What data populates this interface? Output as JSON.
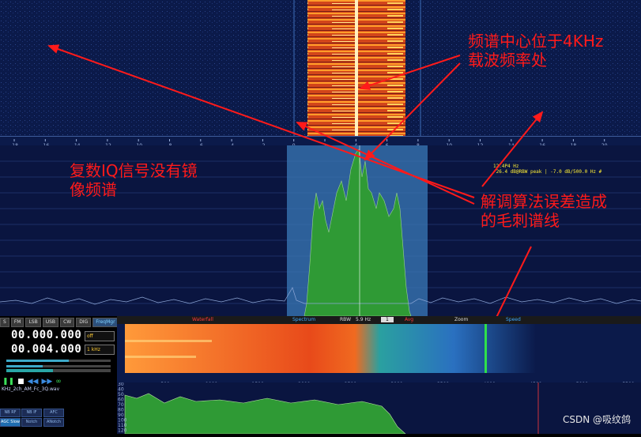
{
  "annotations": {
    "center_line1": "频谱中心位于4KHz",
    "center_line2": "载波频率处",
    "iq_line1": "复数IQ信号没有镜",
    "iq_line2": "像频谱",
    "spur_line1": "解调算法误差造成",
    "spur_line2": "的毛刺谱线"
  },
  "top_axis_ticks": [
    "-18",
    "-16",
    "-14",
    "-12",
    "-10",
    "-8",
    "-6",
    "-4",
    "-2",
    "0",
    "2",
    "4",
    "6",
    "8",
    "10",
    "12",
    "14",
    "16",
    "18",
    "20"
  ],
  "marker_info": {
    "line1": "12.4P4 Hz",
    "line2": "-26.4 dB@RBW peak  |  -7.0 dB/500.0 Hz #"
  },
  "modes": [
    "S",
    "FM",
    "LSB",
    "USB",
    "CW",
    "DIG",
    "FreqMgr"
  ],
  "active_mode": "FreqMgr",
  "frequency": {
    "vfo_a": "00.000.000",
    "vfo_b": "00.004.000",
    "select_a": "off",
    "select_b": "1 kHz"
  },
  "file": {
    "name": "KHz_2ch_AM_Fc_3Q.wav"
  },
  "bottom_buttons": {
    "nb_rf": "NB RF",
    "nb_if": "NB IF",
    "afc": "AFC",
    "agc_slow": "AGC Slow",
    "notch": "Notch",
    "anotch": "ANotch"
  },
  "toolbar": {
    "waterfall": "Waterfall",
    "spectrum": "Spectrum",
    "rbw_label": "RBW",
    "rbw_value": "5.9 Hz",
    "avg_value": "1",
    "avg_label": "Avg",
    "zoom": "Zoom",
    "speed": "Speed"
  },
  "bottom_axis_ticks": [
    "500",
    "1000",
    "1500",
    "2000",
    "2500",
    "3000",
    "3500",
    "4000",
    "4500",
    "5000",
    "5500"
  ],
  "bottom_db_ticks": [
    "30",
    "40",
    "50",
    "60",
    "70",
    "80",
    "90",
    "100",
    "110",
    "120"
  ],
  "watermark": "CSDN @吸纹鸽",
  "colors": {
    "annotation": "#ff1a1a",
    "bg_blue": "#0b1a4a",
    "signal_orange": "#ff7a1a",
    "spectrum_green": "#2f9a35",
    "passband": "#3a7ab8",
    "marker_yellow": "#ffee33"
  }
}
